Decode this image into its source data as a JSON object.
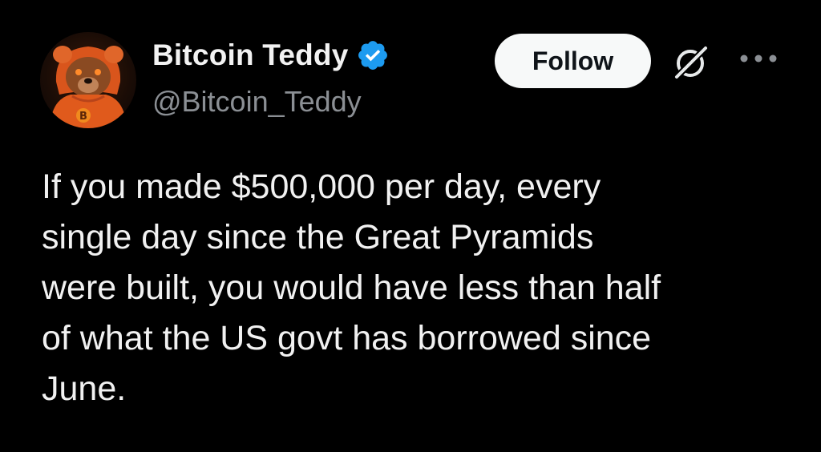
{
  "author": {
    "display_name": "Bitcoin Teddy",
    "handle": "@Bitcoin_Teddy",
    "verified": true
  },
  "actions": {
    "follow_label": "Follow"
  },
  "icons": {
    "verified": "verified-badge-icon",
    "grok": "grok-icon",
    "more": "more-options-icon"
  },
  "colors": {
    "background": "#000000",
    "verified_blue": "#1d9bf0",
    "handle_gray": "#8b8f94",
    "follow_bg": "#f7f9f9"
  },
  "tweet": {
    "text": "If you made $500,000 per day, every\nsingle day since the Great Pyramids\nwere built, you would have less than half\nof what the US govt has borrowed since\nJune."
  }
}
